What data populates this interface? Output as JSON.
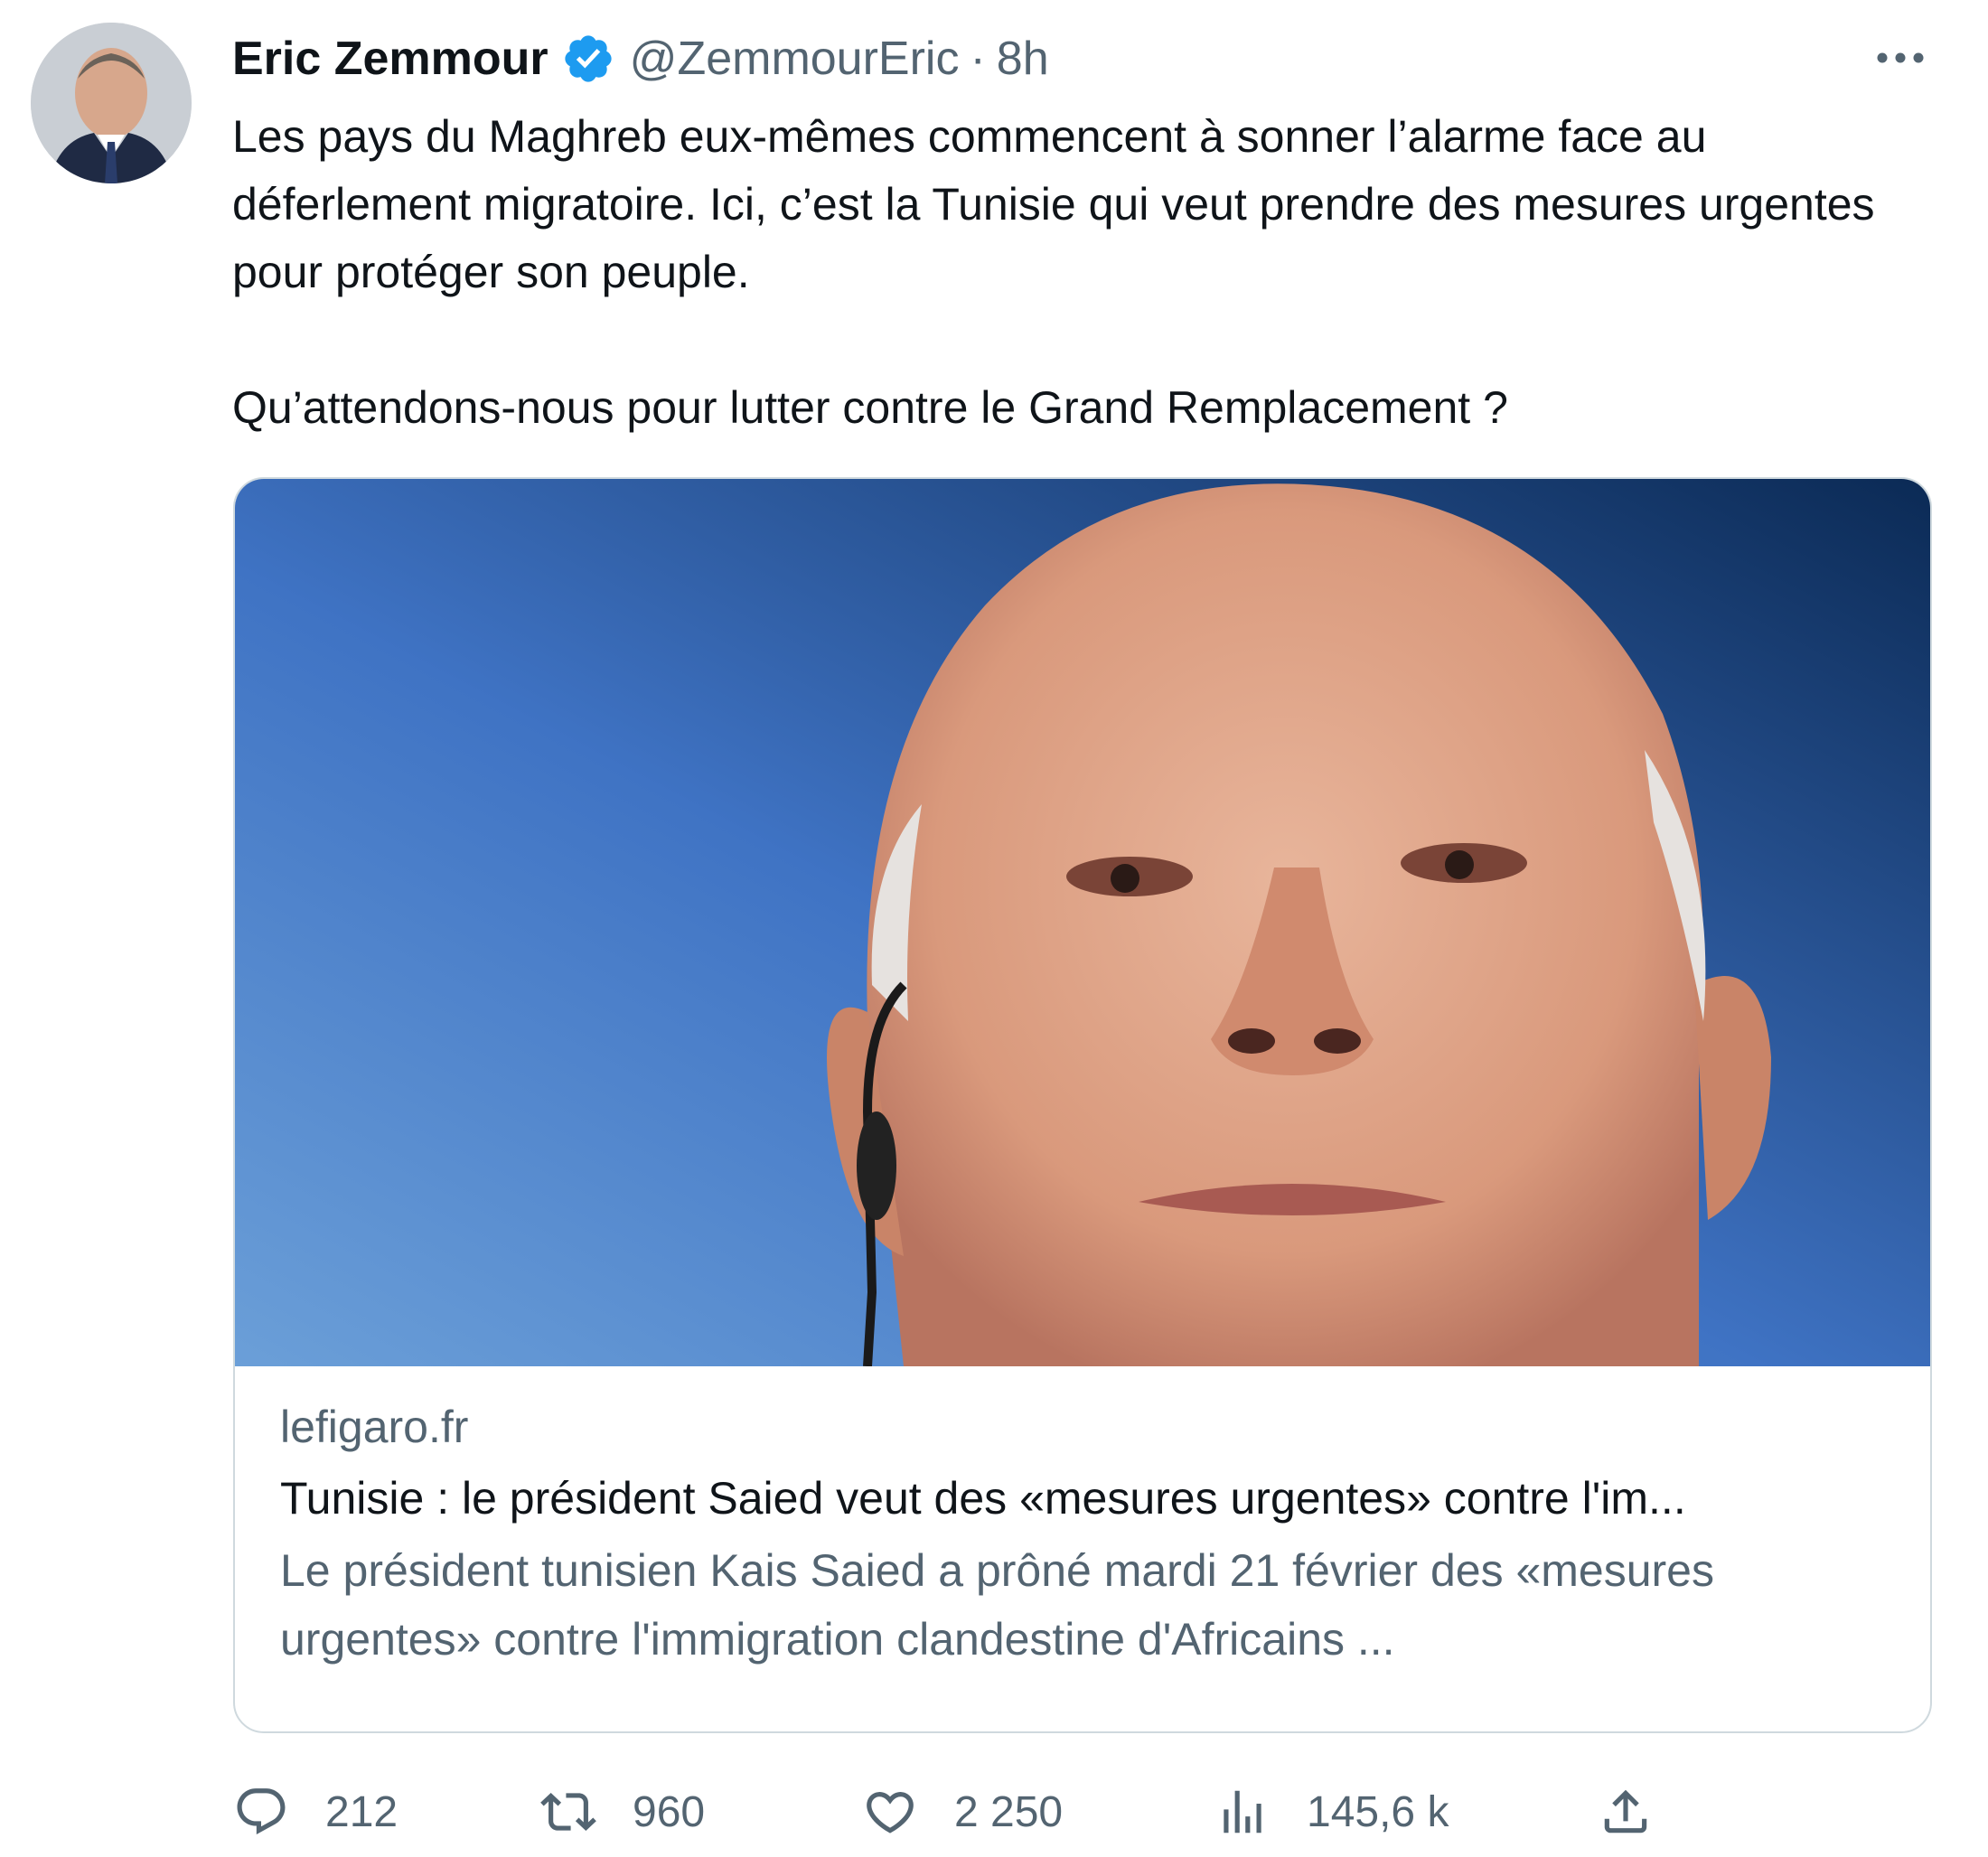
{
  "author": {
    "name": "Eric Zemmour",
    "handle": "@ZemmourEric",
    "separator": "·",
    "time": "8h",
    "verified_color": "#1d9bf0"
  },
  "tweet": {
    "paragraph1": "Les pays du Maghreb eux-mêmes commencent à sonner l’alarme face au déferlement migratoire. Ici, c’est la Tunisie qui veut prendre des mesures urgentes pour protéger son peuple.",
    "paragraph2": "Qu’attendons-nous pour lutter contre le Grand Remplacement ?"
  },
  "card": {
    "domain": "lefigaro.fr",
    "headline": "Tunisie : le président Saied veut des «mesures urgentes» contre l'im...",
    "description": "Le président tunisien Kais Saied a prôné mardi 21 février des «mesures urgentes» contre l'immigration clandestine d'Africains ..."
  },
  "actions": {
    "replies": "212",
    "retweets": "960",
    "likes": "2 250",
    "views": "145,6 k"
  },
  "icons": [
    "verified-badge-icon",
    "more-icon",
    "reply-icon",
    "retweet-icon",
    "like-icon",
    "views-icon",
    "share-icon"
  ]
}
